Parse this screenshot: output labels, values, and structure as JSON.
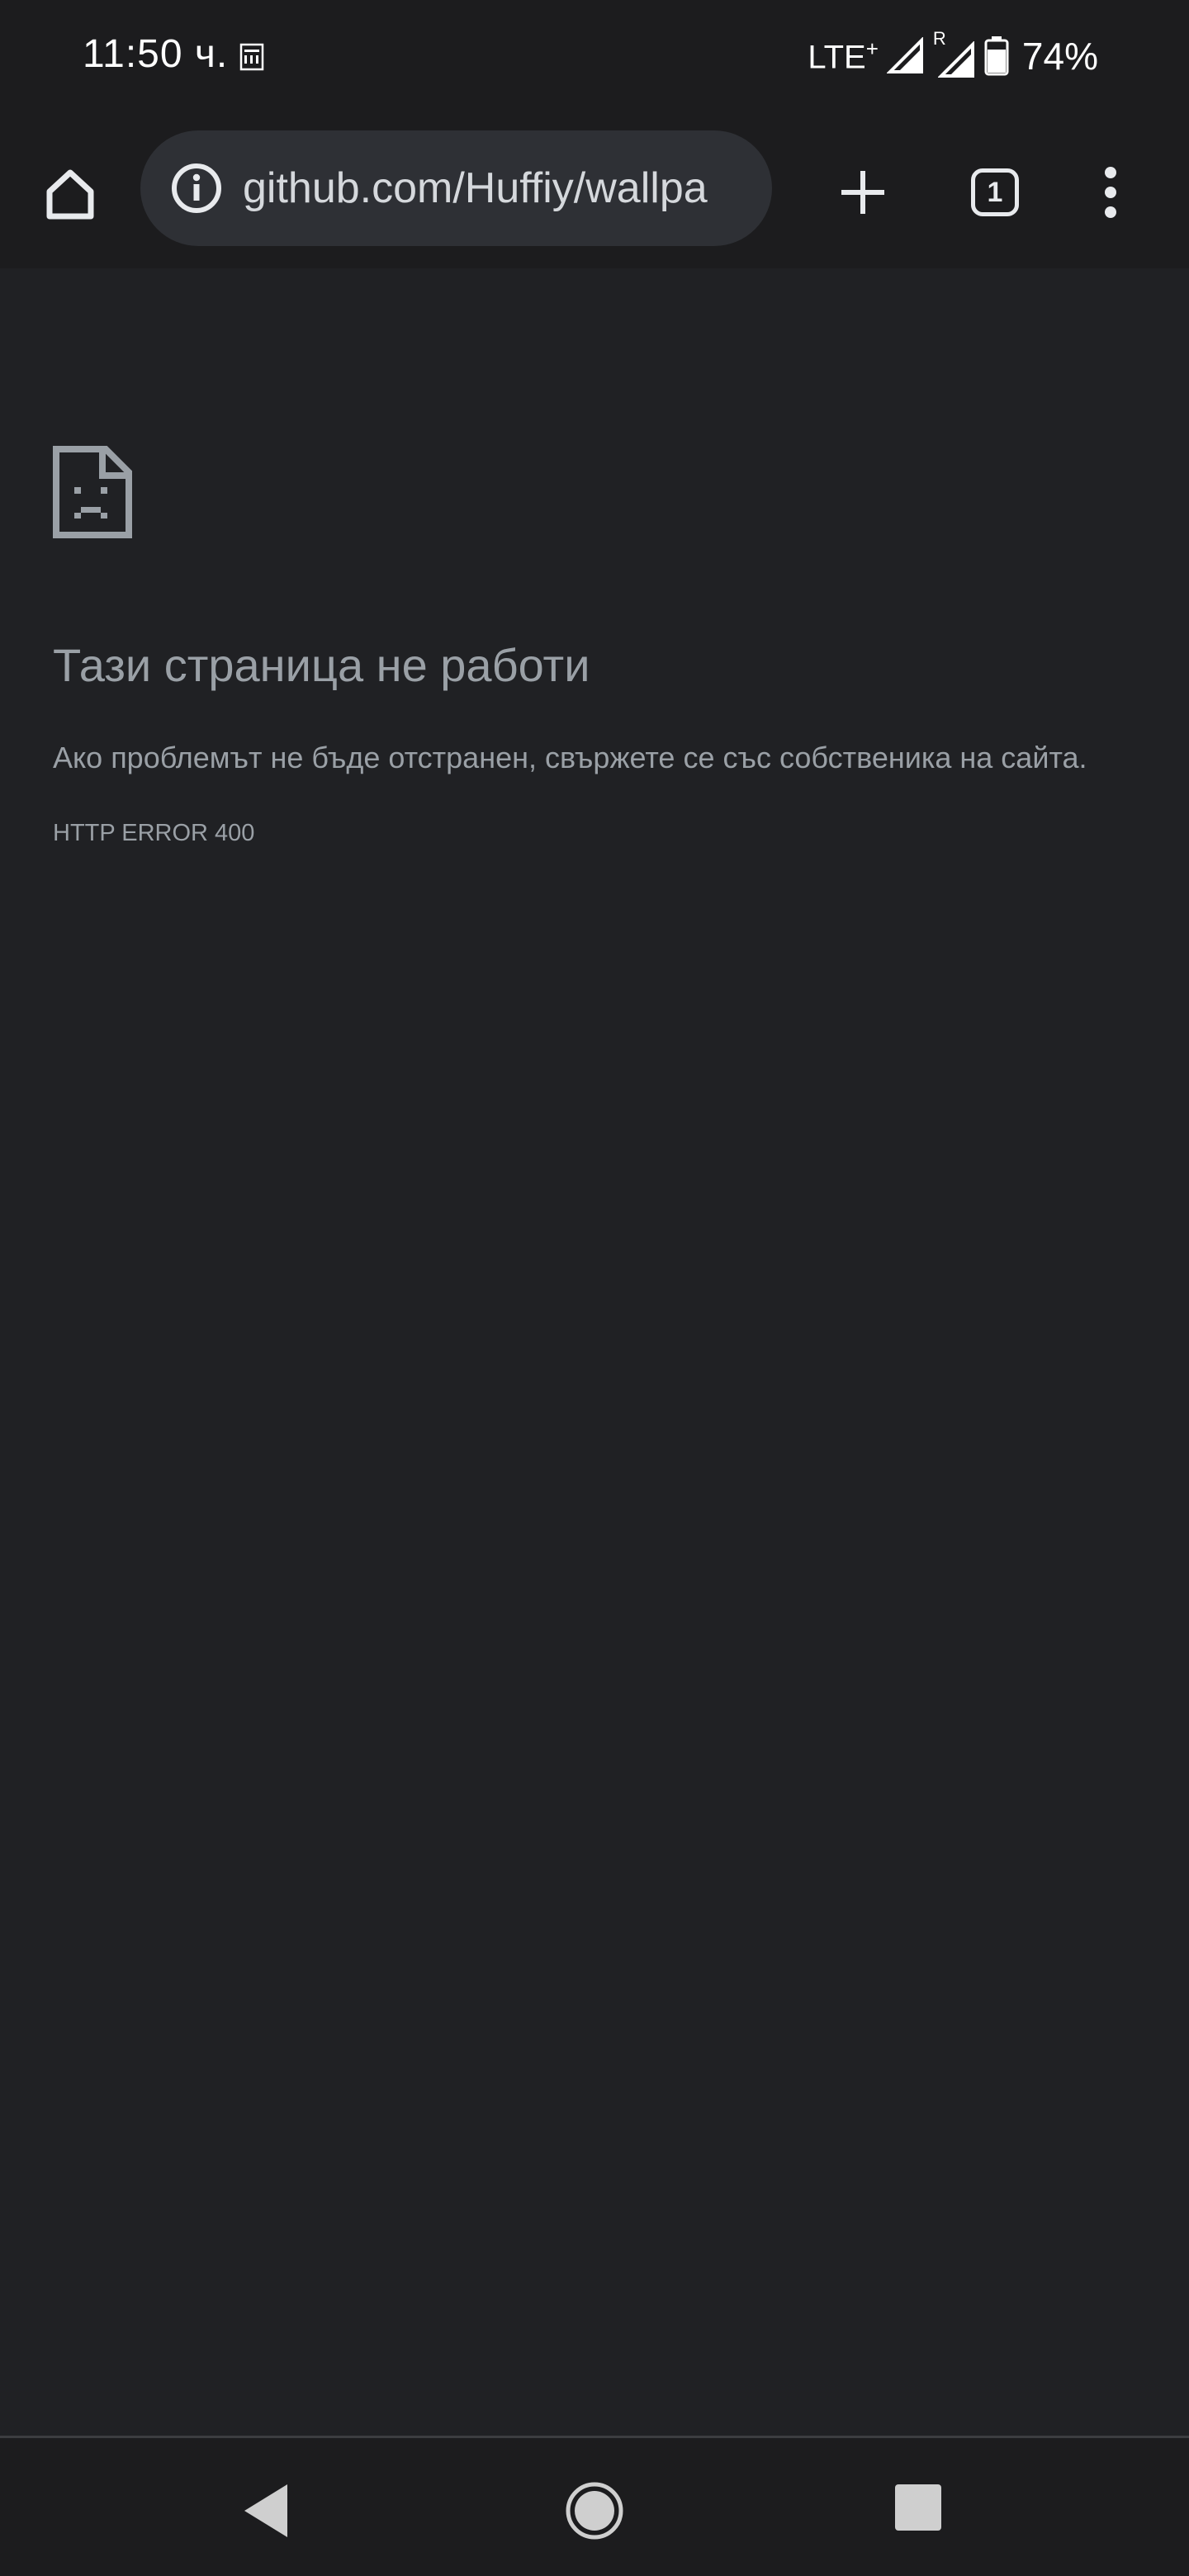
{
  "status_bar": {
    "time": "11:50 ч.",
    "network": "LTE",
    "network_plus": "+",
    "roaming_indicator": "R",
    "battery_percent": "74%"
  },
  "toolbar": {
    "url": "github.com/Huffiy/wallpa",
    "tab_count": "1"
  },
  "error_page": {
    "title": "Тази страница не работи",
    "description": "Ако проблемът не бъде отстранен, свържете се със собственика на сайта.",
    "error_code": "HTTP ERROR 400"
  },
  "colors": {
    "page_background": "#202124",
    "toolbar_background": "#1c1c1e",
    "omnibox_background": "#2e3035",
    "text_muted": "#9aa0a6"
  }
}
